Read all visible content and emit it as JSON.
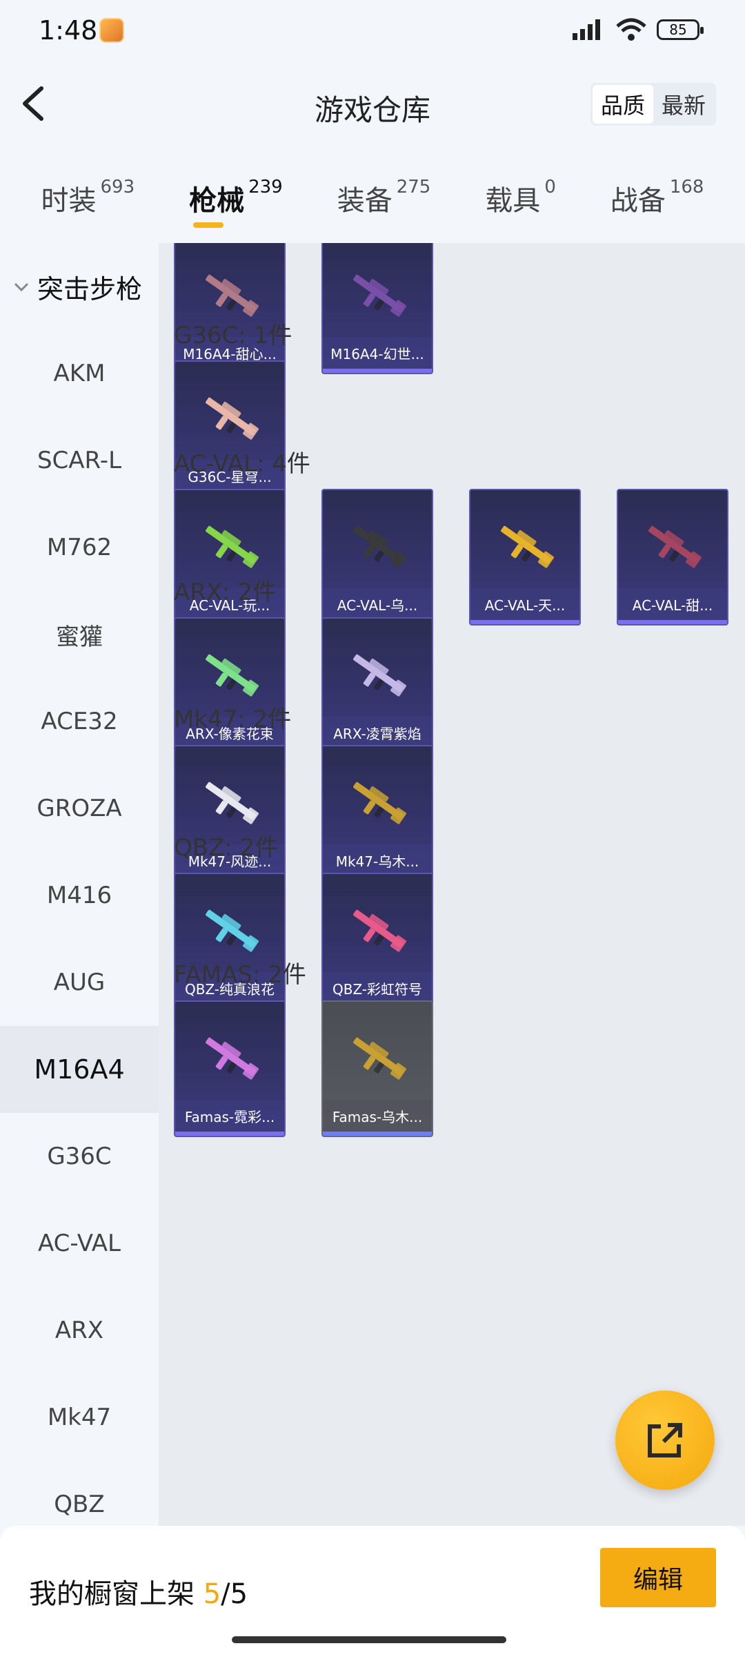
{
  "status": {
    "time": "1:48",
    "battery": "85"
  },
  "header": {
    "title": "游戏仓库",
    "sort_options": [
      "品质",
      "最新"
    ]
  },
  "tabs": [
    {
      "label": "时装",
      "count": "693"
    },
    {
      "label": "枪械",
      "count": "239"
    },
    {
      "label": "装备",
      "count": "275"
    },
    {
      "label": "载具",
      "count": "0"
    },
    {
      "label": "战备",
      "count": "168"
    }
  ],
  "sidebar": {
    "category": "突击步枪",
    "items": [
      "AKM",
      "SCAR-L",
      "M762",
      "蜜獾",
      "ACE32",
      "GROZA",
      "M416",
      "AUG",
      "M16A4",
      "G36C",
      "AC-VAL",
      "ARX",
      "Mk47",
      "QBZ"
    ],
    "active": "M16A4"
  },
  "groups": [
    {
      "title": "",
      "items": [
        {
          "label": "M16A4-甜心..."
        },
        {
          "label": "M16A4-幻世..."
        }
      ]
    },
    {
      "title": "G36C: 1件",
      "items": [
        {
          "label": "G36C-星穹..."
        }
      ]
    },
    {
      "title": "AC-VAL: 4件",
      "items": [
        {
          "label": "AC-VAL-玩..."
        },
        {
          "label": "AC-VAL-乌..."
        },
        {
          "label": "AC-VAL-天..."
        },
        {
          "label": "AC-VAL-甜..."
        }
      ]
    },
    {
      "title": "ARX: 2件",
      "items": [
        {
          "label": "ARX-像素花束"
        },
        {
          "label": "ARX-凌霄紫焰"
        }
      ]
    },
    {
      "title": "Mk47: 2件",
      "items": [
        {
          "label": "Mk47-风迹..."
        },
        {
          "label": "Mk47-乌木..."
        }
      ]
    },
    {
      "title": "QBZ: 2件",
      "items": [
        {
          "label": "QBZ-纯真浪花"
        },
        {
          "label": "QBZ-彩虹符号"
        }
      ]
    },
    {
      "title": "FAMAS: 2件",
      "items": [
        {
          "label": "Famas-霓彩..."
        },
        {
          "label": "Famas-乌木..."
        }
      ]
    }
  ],
  "bottom": {
    "shelf_label": "我的橱窗上架",
    "shelf_current": "5",
    "shelf_total": "/5",
    "edit_label": "编辑"
  },
  "colors": {
    "accent": "#f5ac12",
    "card_bg": "#34336a"
  }
}
